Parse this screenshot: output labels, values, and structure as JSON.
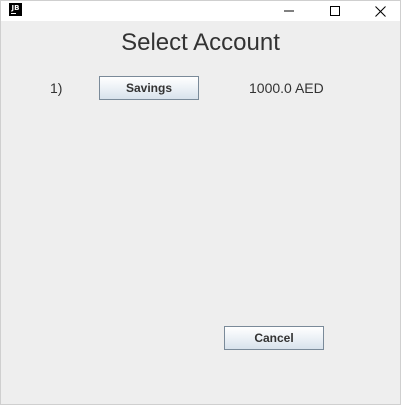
{
  "window": {
    "app_icon_text": "JB",
    "controls": {
      "minimize_icon": "minimize-icon",
      "maximize_icon": "maximize-icon",
      "close_icon": "close-icon"
    }
  },
  "main": {
    "title": "Select Account",
    "accounts": [
      {
        "index": "1)",
        "name": "Savings",
        "balance": "1000.0 AED"
      }
    ],
    "cancel_label": "Cancel"
  },
  "colors": {
    "background": "#eeeeee",
    "button_border": "#7a8a99",
    "text": "#333333"
  }
}
